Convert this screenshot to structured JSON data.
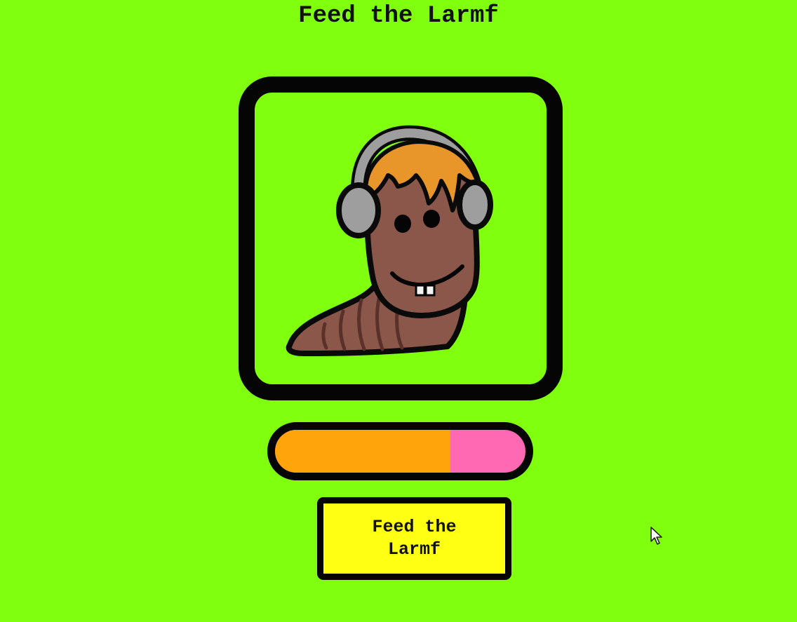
{
  "game": {
    "title": "Feed the Larmf",
    "feed_button_label": "Feed the Larmf",
    "hunger_meter_fraction": 0.7
  },
  "icons": {
    "creature": "larmf-worm-with-headphones-icon",
    "cursor": "mouse-pointer-icon"
  },
  "colors": {
    "background": "#80ff0f",
    "frame": "#050505",
    "meter_fill": "#ffa40a",
    "meter_empty": "#ff69b4",
    "button": "#ffff14"
  }
}
